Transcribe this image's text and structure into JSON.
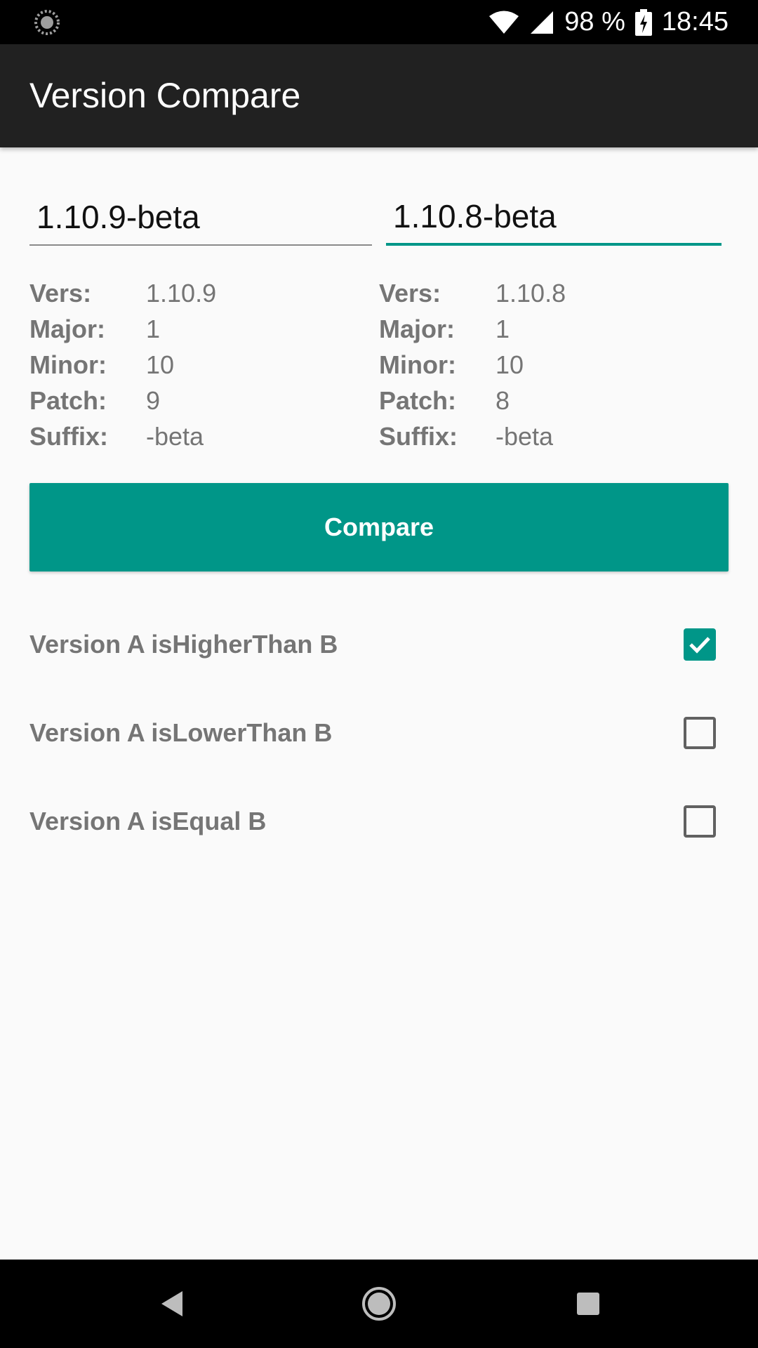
{
  "status_bar": {
    "battery_percent": "98 %",
    "time": "18:45",
    "icons": [
      "loading-icon",
      "wifi-icon",
      "signal-icon",
      "battery-charging-icon"
    ]
  },
  "app_bar": {
    "title": "Version Compare"
  },
  "version_a": {
    "input_value": "1.10.9-beta",
    "rows": [
      {
        "label": "Vers:",
        "value": "1.10.9"
      },
      {
        "label": "Major:",
        "value": "1"
      },
      {
        "label": "Minor:",
        "value": "10"
      },
      {
        "label": "Patch:",
        "value": "9"
      },
      {
        "label": "Suffix:",
        "value": "-beta"
      }
    ]
  },
  "version_b": {
    "input_value": "1.10.8-beta",
    "rows": [
      {
        "label": "Vers:",
        "value": "1.10.8"
      },
      {
        "label": "Major:",
        "value": "1"
      },
      {
        "label": "Minor:",
        "value": "10"
      },
      {
        "label": "Patch:",
        "value": "8"
      },
      {
        "label": "Suffix:",
        "value": "-beta"
      }
    ]
  },
  "compare_button": {
    "label": "Compare"
  },
  "results": [
    {
      "label": "Version A isHigherThan B",
      "checked": true
    },
    {
      "label": "Version A isLowerThan B",
      "checked": false
    },
    {
      "label": "Version A isEqual B",
      "checked": false
    }
  ],
  "colors": {
    "accent": "#009688",
    "app_bar": "#212121",
    "background": "#fafafa"
  },
  "nav_bar": {
    "icons": [
      "back-icon",
      "home-icon",
      "recent-apps-icon"
    ]
  }
}
